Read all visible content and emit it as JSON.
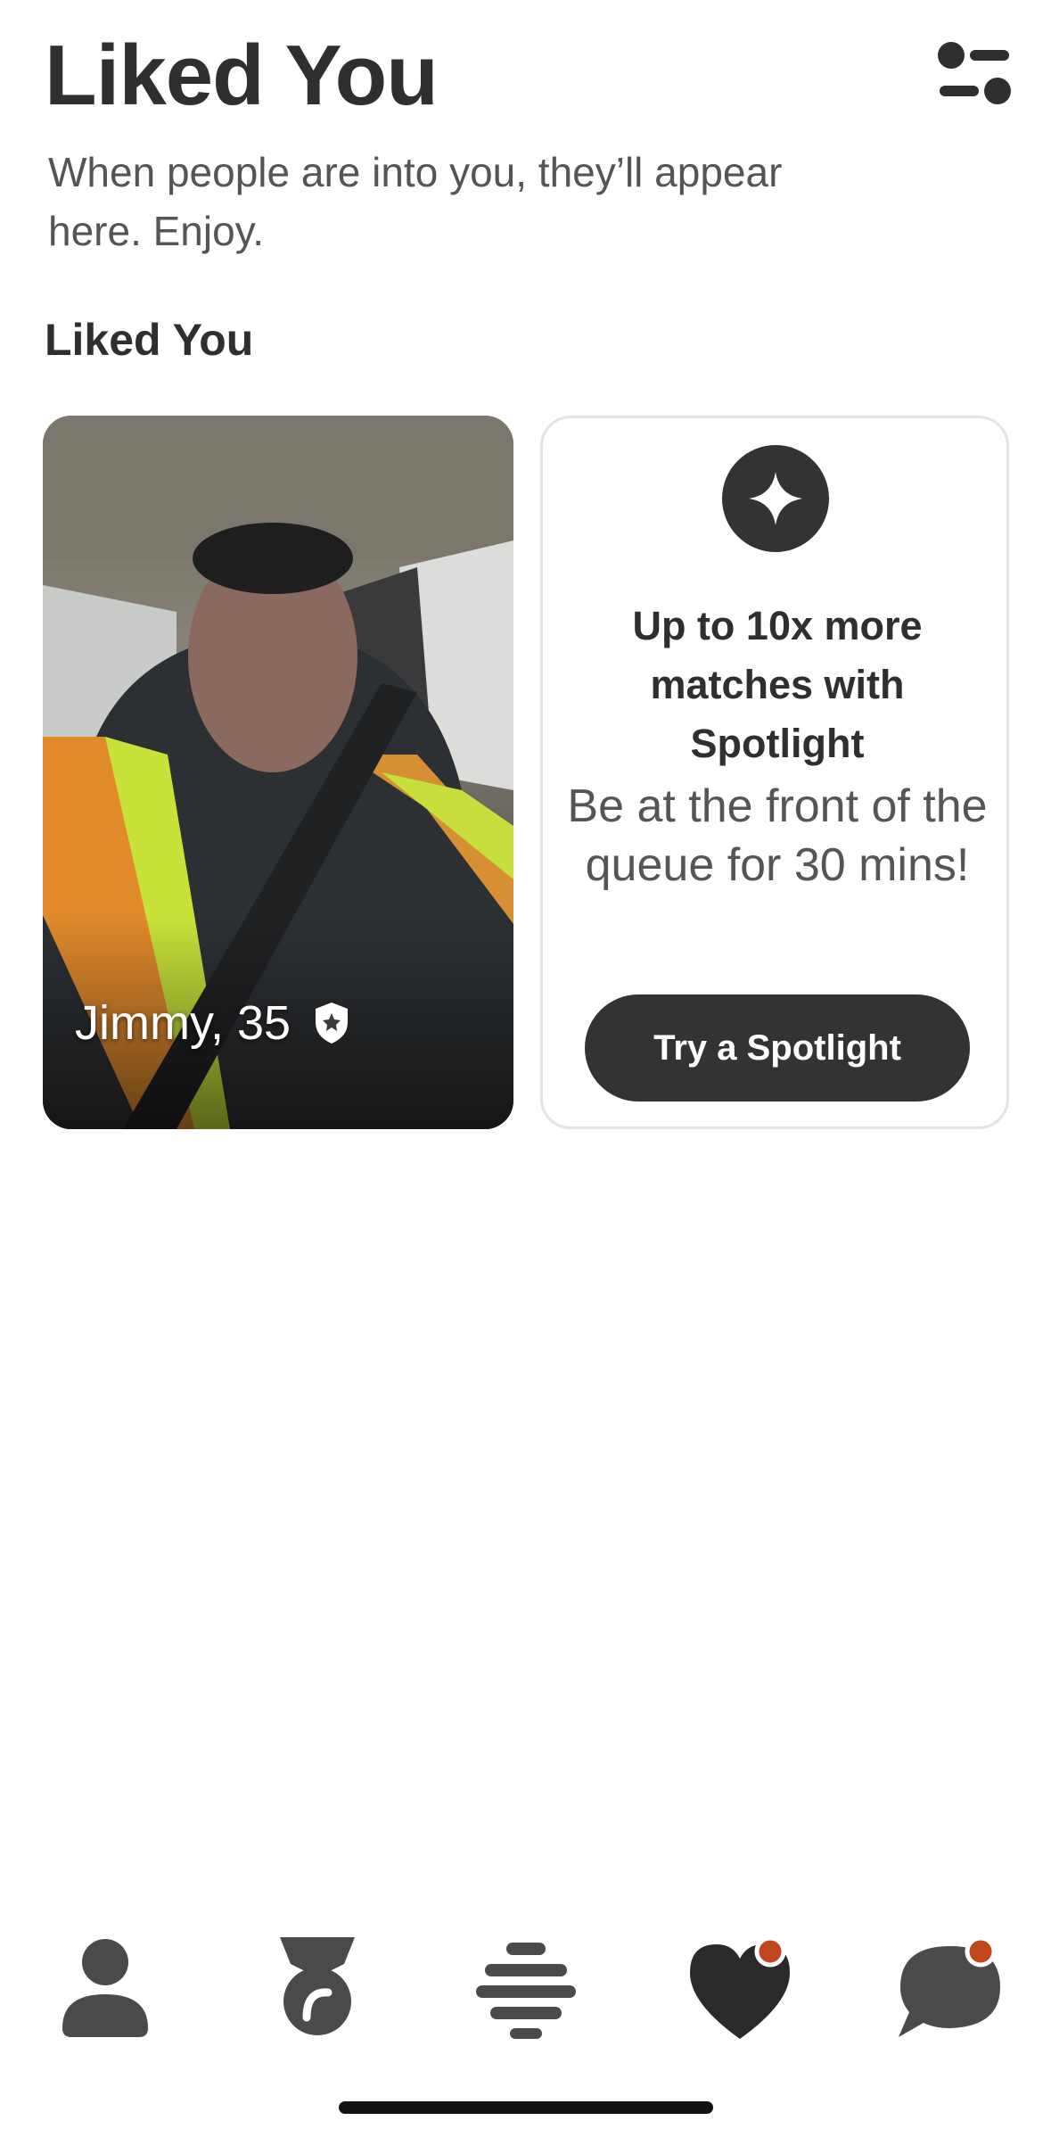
{
  "header": {
    "title": "Liked You",
    "subtitle": "When people are into you, they’ll appear here. Enjoy."
  },
  "section": {
    "heading": "Liked You"
  },
  "profile_card": {
    "name_age": "Jimmy, 35",
    "verified_icon": "verified-badge-icon"
  },
  "spotlight_card": {
    "icon": "spotlight-sparkle-icon",
    "title": "Up to 10x more matches with Spotlight",
    "body": "Be at the front of the queue for 30 mins!",
    "button_label": "Try a Spotlight"
  },
  "tabbar": {
    "items": [
      {
        "name": "profile",
        "icon": "person-icon"
      },
      {
        "name": "discover",
        "icon": "medal-icon"
      },
      {
        "name": "people",
        "icon": "stacked-lines-icon"
      },
      {
        "name": "liked-you",
        "icon": "heart-icon",
        "active": true,
        "notification_dot": true
      },
      {
        "name": "chats",
        "icon": "chat-bubble-icon",
        "notification_dot": true
      }
    ]
  },
  "colors": {
    "primary_dark": "#333333",
    "notification_dot": "#c0461c",
    "background": "#ffffff"
  }
}
